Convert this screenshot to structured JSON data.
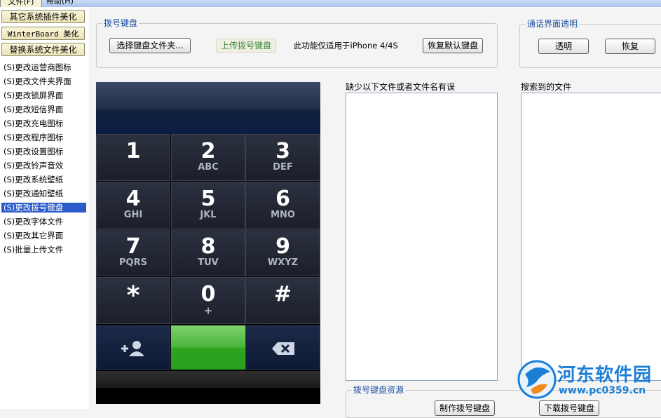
{
  "menubar": {
    "file": "文件(F)",
    "help": "帮助(H)"
  },
  "sidebar": {
    "buttons": [
      "其它系统插件美化",
      "WinterBoard 美化",
      "替换系统文件美化"
    ],
    "items": [
      "(S)更改运营商图标",
      "(S)更改文件夹界面",
      "(S)更改锁屏界面",
      "(S)更改短信界面",
      "(S)更改充电图标",
      "(S)更改程序图标",
      "(S)更改设置图标",
      "(S)更改铃声音效",
      "(S)更改系统壁纸",
      "(S)更改通知壁纸",
      "(S)更改拨号键盘",
      "(S)更改字体文件",
      "(S)更改其它界面",
      "(S)批量上传文件"
    ],
    "selected_index": 10
  },
  "dial_group": {
    "title": "拨号键盘",
    "select_btn": "选择键盘文件夹...",
    "upload_btn": "上传拨号键盘",
    "note": "此功能仅适用于iPhone 4/4S",
    "restore_btn": "恢复默认键盘"
  },
  "call_group": {
    "title": "通话界面透明",
    "transparent_btn": "透明",
    "restore_btn": "恢复"
  },
  "missing_label": "缺少以下文件或者文件名有误",
  "found_label": "搜索到的文件",
  "resource_group": {
    "title": "拨号键盘资源",
    "make_btn": "制作拨号键盘",
    "download_btn": "下载拨号键盘"
  },
  "keypad": {
    "keys": [
      {
        "digit": "1",
        "sub": ""
      },
      {
        "digit": "2",
        "sub": "ABC"
      },
      {
        "digit": "3",
        "sub": "DEF"
      },
      {
        "digit": "4",
        "sub": "GHI"
      },
      {
        "digit": "5",
        "sub": "JKL"
      },
      {
        "digit": "6",
        "sub": "MNO"
      },
      {
        "digit": "7",
        "sub": "PQRS"
      },
      {
        "digit": "8",
        "sub": "TUV"
      },
      {
        "digit": "9",
        "sub": "WXYZ"
      },
      {
        "digit": "*",
        "sub": ""
      },
      {
        "digit": "0",
        "sub": "+"
      },
      {
        "digit": "#",
        "sub": ""
      }
    ],
    "icons": [
      "add-contact-icon",
      "delete-backspace-icon"
    ]
  },
  "watermark": {
    "name": "河东软件园",
    "url": "www.pc0359.cn"
  },
  "colors": {
    "selected_bg": "#2a5bc8",
    "group_title": "#1d4fa3",
    "call_green": "#2ea421",
    "watermark": "#1b7fd6"
  }
}
